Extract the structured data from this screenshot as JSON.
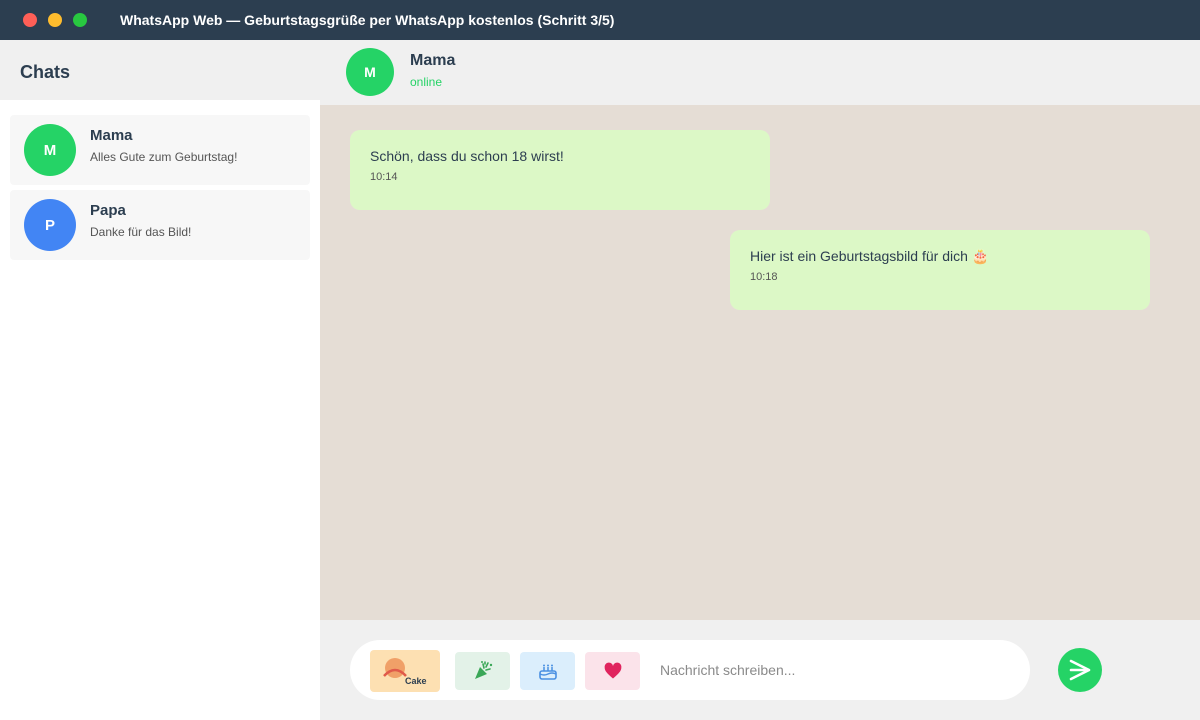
{
  "window": {
    "title": "WhatsApp Web — Geburtstagsgrüße per WhatsApp kostenlos (Schritt 3/5)"
  },
  "sidebar": {
    "title": "Chats",
    "chats": [
      {
        "initial": "M",
        "name": "Mama",
        "preview": "Alles Gute zum Geburtstag!",
        "avatar_color": "#25d366"
      },
      {
        "initial": "P",
        "name": "Papa",
        "preview": "Danke für das Bild!",
        "avatar_color": "#4285f4"
      }
    ]
  },
  "chat_header": {
    "initial": "M",
    "name": "Mama",
    "status": "online"
  },
  "messages": [
    {
      "text": "Schön, dass du schon 18 wirst!",
      "time": "10:14",
      "direction": "incoming"
    },
    {
      "text": "Hier ist ein Geburtstagsbild für dich 🎂",
      "time": "10:18",
      "direction": "outgoing"
    }
  ],
  "composer": {
    "stickers": [
      {
        "icon": "cake-sticker-icon",
        "label": "Cake"
      },
      {
        "icon": "party-popper-icon"
      },
      {
        "icon": "birthday-cake-icon"
      },
      {
        "icon": "heart-icon"
      }
    ],
    "placeholder": "Nachricht schreiben...",
    "value": ""
  },
  "colors": {
    "titlebar": "#2c3e50",
    "accent": "#25d366",
    "bubble": "#dcf8c6",
    "chat_background": "#e5ddd5"
  }
}
